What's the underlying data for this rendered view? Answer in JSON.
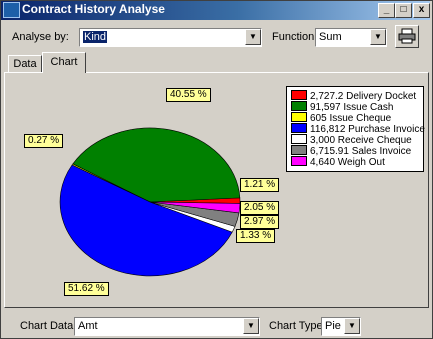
{
  "window": {
    "title": "Contract History Analyse",
    "minimize": "_",
    "maximize": "□",
    "close": "x"
  },
  "toolbar": {
    "analyse_label": "Analyse by:",
    "analyse_value": "Kind",
    "function_label": "Function:",
    "function_value": "Sum",
    "print_icon": "printer-icon"
  },
  "tabs": [
    {
      "label": "Data",
      "active": false
    },
    {
      "label": "Chart",
      "active": true
    }
  ],
  "chart_data": {
    "type": "pie",
    "title": "",
    "legend_position": "top-right",
    "categories": [
      "Delivery Docket",
      "Issue Cash",
      "Issue Cheque",
      "Purchase Invoice",
      "Receive Cheque",
      "Sales Invoice",
      "Weigh Out"
    ],
    "legend": [
      "2,727.2 Delivery Docket",
      "91,597 Issue Cash",
      "605 Issue Cheque",
      "116,812 Purchase Invoice",
      "3,000 Receive Cheque",
      "6,715.91 Sales Invoice",
      "4,640 Weigh Out"
    ],
    "values": [
      2727.2,
      91597,
      605,
      116812,
      3000,
      6715.91,
      4640
    ],
    "percent_labels": [
      "1.21 %",
      "40.55 %",
      "0.27 %",
      "51.62 %",
      "1.33 %",
      "2.97 %",
      "2.05 %"
    ],
    "colors": [
      "#ff0000",
      "#008000",
      "#ffff00",
      "#0000ff",
      "#ffffff",
      "#808080",
      "#ff00ff"
    ]
  },
  "footer": {
    "chart_data_label": "Chart Data:",
    "chart_data_value": "Amt",
    "chart_type_label": "Chart Type:",
    "chart_type_value": "Pie"
  }
}
